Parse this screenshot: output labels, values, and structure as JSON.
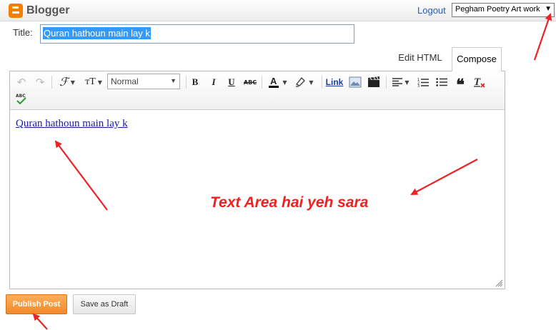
{
  "header": {
    "app_name": "Blogger",
    "logout_label": "Logout",
    "blog_selector": {
      "selected": "Pegham Poetry Art work"
    }
  },
  "post": {
    "title_label": "Title:",
    "title_value": "Quran hathoun main lay k",
    "tabs": [
      {
        "label": "Edit HTML",
        "active": false
      },
      {
        "label": "Compose",
        "active": true
      }
    ],
    "body_text": "Quran hathoun main lay k"
  },
  "toolbar": {
    "format_select": {
      "selected": "Normal"
    },
    "link_label": "Link",
    "icons": [
      "undo-icon",
      "redo-icon",
      "font-family-icon",
      "font-size-icon",
      "bold-icon",
      "italic-icon",
      "underline-icon",
      "strikethrough-icon",
      "text-color-icon",
      "highlight-icon",
      "link-icon",
      "image-icon",
      "video-icon",
      "align-icon",
      "numbered-list-icon",
      "bullet-list-icon",
      "blockquote-icon",
      "remove-formatting-icon",
      "spellcheck-icon"
    ]
  },
  "annotation": {
    "text": "Text Area hai yeh sara",
    "color": "#ee2222"
  },
  "actions": {
    "publish_label": "Publish Post",
    "draft_label": "Save as Draft"
  },
  "colors": {
    "publish": "#f28a2a",
    "brand": "#f57d00",
    "link": "#1a1aaa",
    "arrow": "#ee2222"
  }
}
